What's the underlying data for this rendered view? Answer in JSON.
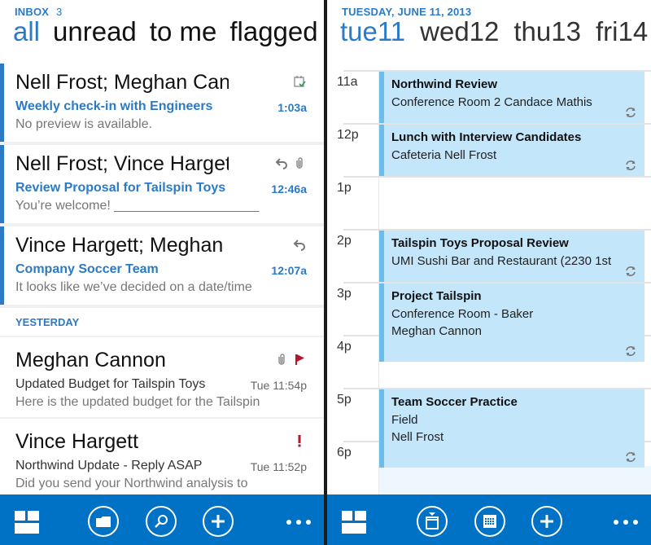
{
  "mail": {
    "header": {
      "folder": "INBOX",
      "unread_count": "3"
    },
    "pivots": [
      "all",
      "unread",
      "to me",
      "flagged"
    ],
    "active_pivot": "all",
    "section_yesterday": "YESTERDAY",
    "items": [
      {
        "sender": "Nell Frost; Meghan Cannon",
        "subject": "Weekly check-in with Engineers",
        "preview": "No preview is available.",
        "time": "1:03a",
        "unread": true,
        "icons": [
          "calendar-accepted-icon"
        ]
      },
      {
        "sender": "Nell Frost; Vince Hargett",
        "subject": "Review Proposal for Tailspin Toys",
        "preview": "You’re welcome!  ____________________",
        "time": "12:46a",
        "unread": true,
        "icons": [
          "replied-icon",
          "attachment-icon"
        ]
      },
      {
        "sender": "Vince Hargett; Meghan Cannon",
        "subject": "Company Soccer Team",
        "preview": "It looks like we’ve decided on a date/time",
        "time": "12:07a",
        "unread": true,
        "icons": [
          "replied-icon"
        ]
      },
      {
        "sender": "Meghan Cannon",
        "subject": "Updated Budget for Tailspin Toys",
        "preview": "Here is the updated budget for the Tailspin",
        "time": "Tue 11:54p",
        "unread": false,
        "icons": [
          "attachment-icon",
          "flag-icon"
        ]
      },
      {
        "sender": "Vince Hargett",
        "subject": "Northwind Update - Reply ASAP",
        "preview": "Did you send your Northwind analysis to",
        "time": "Tue 11:52p",
        "unread": false,
        "icons": [
          "high-importance-icon"
        ]
      }
    ],
    "appbar": [
      "tiles-view-button",
      "folders-button",
      "search-button",
      "new-message-button",
      "more-button"
    ]
  },
  "calendar": {
    "header": {
      "date": "TUESDAY, JUNE 11, 2013"
    },
    "pivots": [
      "tue11",
      "wed12",
      "thu13",
      "fri14"
    ],
    "active_pivot": "tue11",
    "hours": [
      "11a",
      "12p",
      "1p",
      "2p",
      "3p",
      "4p",
      "5p",
      "6p"
    ],
    "appointments": [
      {
        "title": "Northwind Review",
        "line2": "Conference Room 2 Candace Mathis",
        "line3": "",
        "recurring": true,
        "start": "11a",
        "end": "12p"
      },
      {
        "title": "Lunch with Interview Candidates",
        "line2": "Cafeteria Nell Frost",
        "line3": "",
        "recurring": true,
        "start": "12p",
        "end": "1p"
      },
      {
        "title": "Tailspin Toys Proposal Review",
        "line2": "UMI Sushi Bar and Restaurant (2230 1st",
        "line3": "",
        "recurring": true,
        "start": "2p",
        "end": "3p"
      },
      {
        "title": "Project Tailspin",
        "line2": "Conference Room - Baker",
        "line3": "Meghan Cannon",
        "recurring": true,
        "start": "3p",
        "end": "4:30p"
      },
      {
        "title": "Team Soccer Practice",
        "line2": "Field",
        "line3": "Nell Frost",
        "recurring": true,
        "start": "5p",
        "end": "6:30p"
      }
    ],
    "appbar": [
      "tiles-view-button",
      "today-button",
      "month-view-button",
      "new-appointment-button",
      "more-button"
    ]
  },
  "colors": {
    "accent": "#2a7ac6",
    "appbar": "#0072c6",
    "appointment_fill": "#c3e6fb",
    "appointment_bar": "#6cbde9",
    "flag": "#b0182d"
  }
}
